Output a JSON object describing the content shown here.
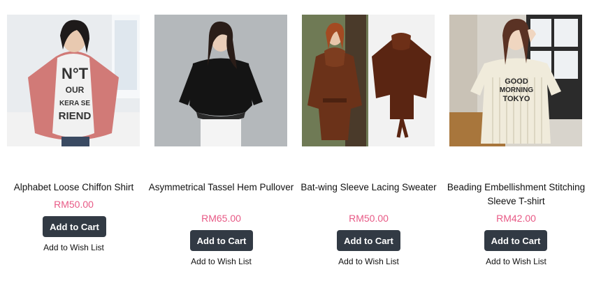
{
  "products": [
    {
      "title": "Alphabet Loose Chiffon Shirt",
      "price": "RM50.00",
      "cart_label": "Add to Cart",
      "wish_label": "Add to Wish List",
      "shirt_text": [
        "N°T",
        "OUR",
        "KERA SE",
        "RIEND"
      ]
    },
    {
      "title": "Asymmetrical Tassel Hem Pullover",
      "price": "RM65.00",
      "cart_label": "Add to Cart",
      "wish_label": "Add to Wish List"
    },
    {
      "title": "Bat-wing Sleeve Lacing Sweater",
      "price": "RM50.00",
      "cart_label": "Add to Cart",
      "wish_label": "Add to Wish List"
    },
    {
      "title": "Beading Embellishment Stitching Sleeve T-shirt",
      "price": "RM42.00",
      "cart_label": "Add to Cart",
      "wish_label": "Add to Wish List",
      "shirt_text": [
        "GOOD",
        "MORNING",
        "TOKYO"
      ]
    }
  ],
  "colors": {
    "price": "#e85a86",
    "button": "#323a44"
  }
}
